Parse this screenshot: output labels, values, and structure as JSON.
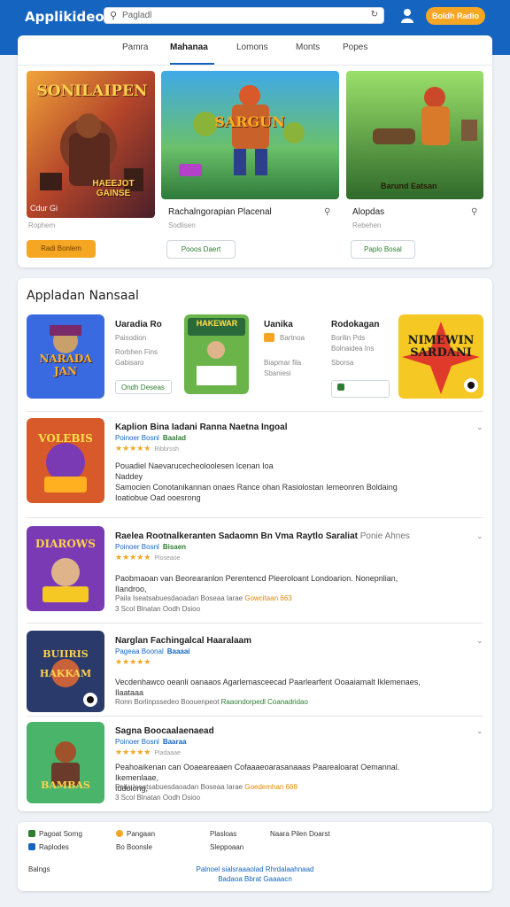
{
  "header": {
    "brand": "Applikideo",
    "search_placeholder": "Pagladl",
    "cta_label": "Boldh Radio",
    "colors": {
      "bar": "#1565c0",
      "cta": "#f5a623"
    }
  },
  "tabs": [
    "Pamra",
    "Mahanaa",
    "Lomons",
    "Monts",
    "Popes"
  ],
  "featured": [
    {
      "art_text": "SONILAIPEN",
      "art_sub": "HAEEJOT GAINSE",
      "caption": "Cdur Gi",
      "sub": "Rophem",
      "button": "Radi Bonlem"
    },
    {
      "art_text": "SARGUN",
      "title": "Rachalngorapian Placenal",
      "sub": "Sodlisen",
      "button": "Pooos Daert"
    },
    {
      "art_text": "Barund Eatsan",
      "title": "Alopdas",
      "sub": "Rebehen",
      "button": "Paplo Bosal"
    }
  ],
  "section": {
    "title": "Appladan Nansaal",
    "minis": [
      {
        "art": "NARADA JAN",
        "title": "Uaradia Ro",
        "l1": "Paisodion",
        "l2": "Rorbhen Fins",
        "l3": "Gabisaro",
        "btn": "Ondh Deseas"
      },
      {
        "art": "HAKEWAR",
        "title": "",
        "l1": "",
        "l2": "",
        "l3": "",
        "btn": ""
      },
      {
        "art": "",
        "title": "Uanika",
        "l1": "Bartnoa",
        "l2": "Biapmar fila",
        "l3": "Sbaniesi",
        "btn": ""
      },
      {
        "art": "",
        "title": "Rodokagan",
        "l1": "Borilin Pds",
        "l2": "Bolnaidea Ins",
        "l3": "Sborsa",
        "btn": ""
      },
      {
        "art": "NIMEWIN SARDANI",
        "title": "",
        "l1": "",
        "l2": "",
        "l3": "",
        "btn": ""
      }
    ],
    "rows": [
      {
        "art": "VOLEBIS",
        "title": "Kaplion Bina Iadani Ranna Naetna Ingoal",
        "suffix": "",
        "sub": "Poinoer Bosnl",
        "tag": "Baalad",
        "reviews": "Ribbrssh",
        "rating": 5,
        "desc": "Pouadiel Naevarucecheoloolesen Icenan Ioa\nNaddey\nSamocien Conotanikannan onaes Rance ohan Rasiolostan Iemeonren Boldaing\nIoatiobue Oad ooesrong",
        "meta": "",
        "meta_hl": ""
      },
      {
        "art": "DIAROWS",
        "title": "Raelea Rootnalkeranten  Sadaomn Bn Vma Raytlo Saraliat",
        "suffix": "Ponie Ahnes",
        "sub": "Poinoer Bosnl",
        "tag": "Bisaen",
        "reviews": "Ploseaoe",
        "rating": 5,
        "desc": "Paobmaoan van Beorearanlon Perentencd Pleeroloant Londoarion. Nonepnlian,\nIIandroo,",
        "meta": "Paila Iseatsabuesdaoadan  Boseaa Iarae",
        "meta_hl": "Gowcitaan 663",
        "meta2": "3 Scol Blnatan Oodh Dsioo"
      },
      {
        "art": "BUIIRIS HAKKAM",
        "title": "Narglan Fachingalcal Haaralaam",
        "suffix": "",
        "sub": "Pageaa Boonal",
        "tag": "Baaaai",
        "reviews": "",
        "rating": 5,
        "desc": "Vecdenhawco oeanli oanaaos Agarlemasceecad Paarlearfent Ooaaiamalt Iklemenaes,\nIlaataaa",
        "meta": "Ronn Borlinpssedeo Boouenpeot",
        "meta_hl_g": "Raaondorpedl Coanadridao"
      },
      {
        "art": "BAMBAS",
        "title": "Sagna Boocaalaenaead",
        "suffix": "",
        "sub": "Poinoer Bosnl",
        "tag": "Baaraa",
        "reviews": "Pladaaae",
        "rating": 5,
        "desc": "Peahoaikenan can Ooaeareaaen Cofaaaeoarasanaaas Paarealoarat Oemannal. Ikemenlaae,\nIddolong,",
        "meta": "Paila Iseatsabuesdaoadan  Boseaa Iarae",
        "meta_hl": "Goedemhan 668",
        "meta2": "3 Scol Blnatan Oodh Dsioo"
      }
    ]
  },
  "footer": {
    "items": [
      "Pagoat Sorng",
      "Pangaan",
      "Plasloas",
      "Naara Pilen Doarst",
      "Raplodes",
      "Bo Boonsle",
      "Sleppoaan",
      "Balngs"
    ],
    "center_link_1": "Palnoel sialsraaaolad Rhrdalaahnaad",
    "center_link_2": "Badaoa Bbrat Gaaaacn"
  }
}
